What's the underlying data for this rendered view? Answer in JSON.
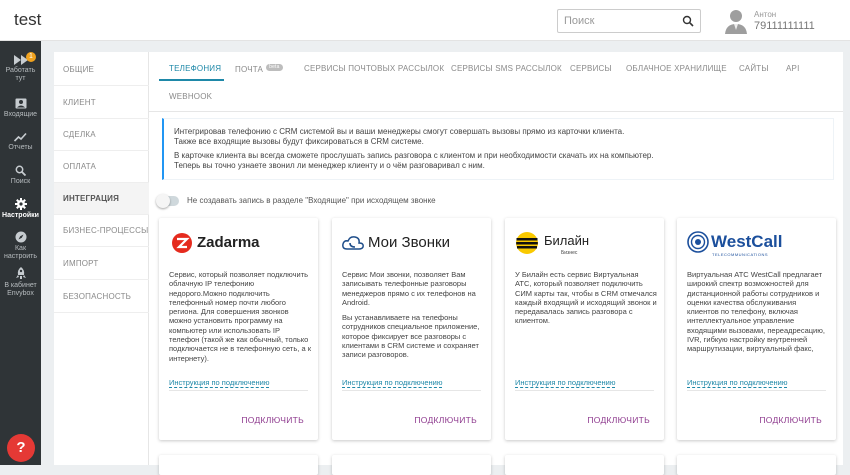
{
  "app": {
    "title": "test"
  },
  "search": {
    "placeholder": "Поиск"
  },
  "user": {
    "name": "Антон",
    "phone": "79111111111"
  },
  "sidebar": {
    "items": [
      {
        "label": "Работать тут",
        "icon": "fast-forward-icon",
        "badge": "1"
      },
      {
        "label": "Входящие",
        "icon": "inbox-icon"
      },
      {
        "label": "Отчеты",
        "icon": "trend-chart-icon"
      },
      {
        "label": "Поиск",
        "icon": "search-icon"
      },
      {
        "label": "Настройки",
        "icon": "gear-icon",
        "active": true
      },
      {
        "label": "Как настроить",
        "icon": "compass-icon"
      },
      {
        "label": "В кабинет Envybox",
        "icon": "rocket-icon"
      }
    ],
    "help": "?"
  },
  "subnav": {
    "items": [
      "ОБЩИЕ",
      "КЛИЕНТ",
      "СДЕЛКА",
      "ОПЛАТА",
      "ИНТЕГРАЦИЯ",
      "БИЗНЕС-ПРОЦЕССЫ",
      "ИМПОРТ",
      "БЕЗОПАСНОСТЬ"
    ],
    "active": "ИНТЕГРАЦИЯ"
  },
  "tabs": {
    "items": [
      "ТЕЛЕФОНИЯ",
      "ПОЧТА",
      "СЕРВИСЫ ПОЧТОВЫХ РАССЫЛОК",
      "СЕРВИСЫ SMS РАССЫЛОК",
      "СЕРВИСЫ",
      "ОБЛАЧНОЕ ХРАНИЛИЩЕ",
      "САЙТЫ",
      "API",
      "WEBHOOK"
    ],
    "beta": "beta",
    "active": "ТЕЛЕФОНИЯ"
  },
  "info": {
    "line1": "Интегрировав телефонию с CRM системой вы и ваши менеджеры смогут совершать вызовы прямо из карточки клиента.",
    "line2": "Также все входящие вызовы будут фиксироваться в CRM системе.",
    "line3": "В карточке клиента вы всегда сможете прослушать запись разговора с клиентом и при необходимости скачать их на компьютер.",
    "line4": "Теперь вы точно узнаете звонил ли менеджер клиенту и о чём разговаривал с ним."
  },
  "toggle": {
    "label": "Не создавать запись в разделе \"Входящие\" при исходящем звонке",
    "on": false
  },
  "cards": [
    {
      "name": "Zadarma",
      "logo_icon": "zadarma-logo-icon",
      "desc": [
        "Сервис, который позволяет подключить облачную IP телефонию недорого.Можно подключить телефонный номер почти любого региона. Для совершения звонков можно установить программу на компьютер или использовать IP телефон (такой же как обычный, только подключается не в телефонную сеть, а к интернету)."
      ],
      "guide": "Инструкция по подключению",
      "connect": "ПОДКЛЮЧИТЬ"
    },
    {
      "name": "Мои Звонки",
      "logo_icon": "cloud-phone-icon",
      "desc": [
        "Сервис Мои звонки, позволяет Вам записывать телефонные разговоры менеджеров прямо с их телефонов на Android.",
        "Вы устанавливаете на телефоны сотрудников специальное приложение, которое фиксирует все разговоры с клиентами в CRM системе и сохраняет записи разговоров."
      ],
      "guide": "Инструкция по подключению",
      "connect": "ПОДКЛЮЧИТЬ"
    },
    {
      "name": "Билайн",
      "sub": "Бизнес",
      "logo_icon": "beeline-logo-icon",
      "desc": [
        "У Билайн есть сервис Виртуальная АТС, который позволяет подключить СИМ карты так, чтобы в CRM отмечался каждый входящий и исходящий звонок и передавалась запись разговора с клиентом."
      ],
      "guide": "Инструкция по подключению",
      "connect": "ПОДКЛЮЧИТЬ"
    },
    {
      "name": "WestCall",
      "sub": "TELECOMMUNICATIONS",
      "logo_icon": "westcall-logo-icon",
      "desc": [
        "Виртуальная АТС WestCall предлагает широкий спектр возможностей для дистанционной работы сотрудников и оценки качества обслуживания клиентов по телефону, включая интеллектуальное управление входящими вызовами, переадресацию, IVR, гибкую настройку внутренней маршрутизации, виртуальный факс,"
      ],
      "guide": "Инструкция по подключению",
      "connect": "ПОДКЛЮЧИТЬ"
    }
  ],
  "colors": {
    "accent": "#1e88a8",
    "connect": "#8e3a8e",
    "sidebar": "#2f3437",
    "badge": "#f0a21e",
    "help": "#e53935"
  }
}
